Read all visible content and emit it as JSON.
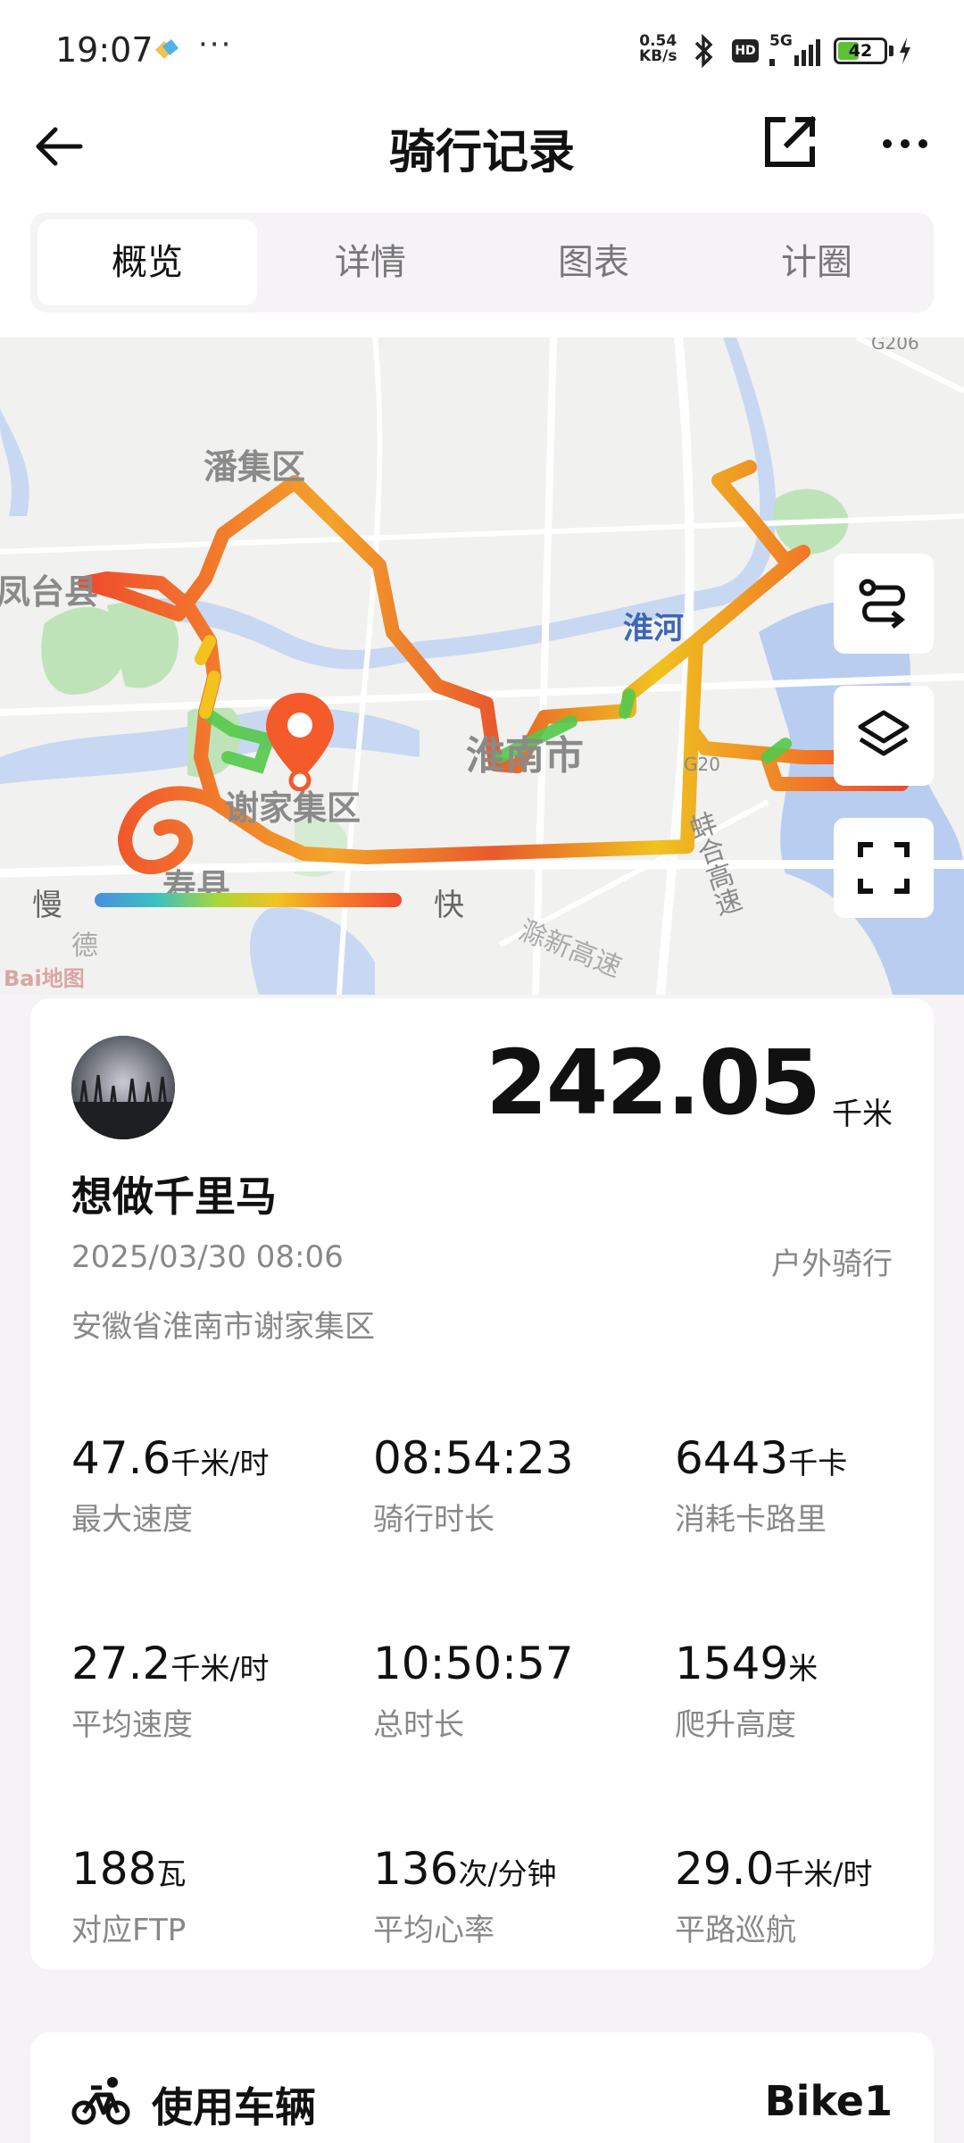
{
  "status_bar": {
    "time": "19:07",
    "dots": "···",
    "net_speed_value": "0.54",
    "net_speed_unit": "KB/s",
    "hd_badge": "HD",
    "signal_label": "5G",
    "battery_level": "42",
    "battery_fraction": 0.42,
    "icons": [
      "app-notification-icon",
      "bluetooth-icon",
      "signal-icon",
      "battery-icon",
      "charging-icon"
    ]
  },
  "header": {
    "title": "骑行记录",
    "icons": [
      "back-arrow-icon",
      "share-edit-icon",
      "more-icon"
    ]
  },
  "tabs": [
    {
      "label": "概览",
      "active": true
    },
    {
      "label": "详情",
      "active": false
    },
    {
      "label": "图表",
      "active": false
    },
    {
      "label": "计圈",
      "active": false
    }
  ],
  "map": {
    "labels": {
      "panji": "潘集区",
      "fengtai": "凤台县",
      "huaihe": "淮河",
      "huainan": "淮南市",
      "xiejiaji": "谢家集区",
      "shouxian": "寿县",
      "road_g206": "G206",
      "road_g20": "G20",
      "bengfu": "蚌合高速",
      "chuxin": "滁新高速",
      "de": "德"
    },
    "legend": {
      "slow": "慢",
      "fast": "快"
    },
    "logo": "Bai地图",
    "controls": [
      "route-icon",
      "layers-icon",
      "fullscreen-icon"
    ]
  },
  "summary": {
    "distance": "242.05",
    "distance_unit": "千米",
    "user_name": "想做千里马",
    "datetime": "2025/03/30 08:06",
    "ride_type": "户外骑行",
    "location": "安徽省淮南市谢家集区",
    "stats": [
      {
        "value": "47.6",
        "unit": "千米/时",
        "label": "最大速度"
      },
      {
        "value": "08:54:23",
        "unit": "",
        "label": "骑行时长"
      },
      {
        "value": "6443",
        "unit": "千卡",
        "label": "消耗卡路里"
      },
      {
        "value": "27.2",
        "unit": "千米/时",
        "label": "平均速度"
      },
      {
        "value": "10:50:57",
        "unit": "",
        "label": "总时长"
      },
      {
        "value": "1549",
        "unit": "米",
        "label": "爬升高度"
      },
      {
        "value": "188",
        "unit": "瓦",
        "label": "对应FTP"
      },
      {
        "value": "136",
        "unit": "次/分钟",
        "label": "平均心率"
      },
      {
        "value": "29.0",
        "unit": "千米/时",
        "label": "平路巡航"
      }
    ]
  },
  "vehicle": {
    "title": "使用车辆",
    "name": "Bike1"
  },
  "colors": {
    "accent_pin": "#f45a2a",
    "route_fast": "#f04b2d",
    "route_mid": "#f3c21f",
    "route_slow": "#3cc03c",
    "water": "#b9cdf0",
    "park": "#bfe3b9"
  }
}
